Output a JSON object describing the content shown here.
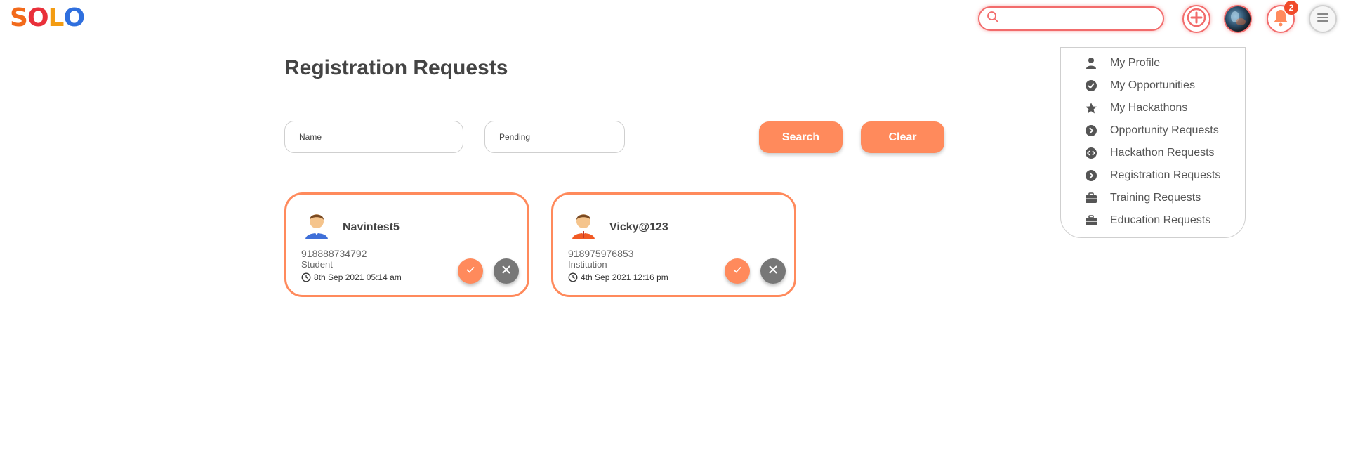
{
  "header": {
    "logo_letters": [
      "S",
      "O",
      "L",
      "O"
    ],
    "search": {
      "value": "",
      "placeholder": ""
    },
    "notification_count": "2",
    "icons": {
      "search": "search-icon",
      "add": "plus-circle-icon",
      "avatar": "user-avatar",
      "notifications": "bell-icon",
      "menu": "hamburger-menu-icon"
    },
    "accent_color": "#f26b6b"
  },
  "dropdown": {
    "items": [
      {
        "label": "My Profile",
        "icon": "user-icon"
      },
      {
        "label": "My Opportunities",
        "icon": "check-circle-icon"
      },
      {
        "label": "My Hackathons",
        "icon": "star-icon"
      },
      {
        "label": "Opportunity Requests",
        "icon": "chevron-circle-icon"
      },
      {
        "label": "Hackathon Requests",
        "icon": "code-circle-icon"
      },
      {
        "label": "Registration Requests",
        "icon": "chevron-circle-icon"
      },
      {
        "label": "Training Requests",
        "icon": "briefcase-icon"
      },
      {
        "label": "Education Requests",
        "icon": "briefcase-icon"
      }
    ]
  },
  "main": {
    "title": "Registration Requests",
    "filters": {
      "name": {
        "value": "",
        "placeholder": "Name"
      },
      "status": {
        "value": "Pending"
      }
    },
    "search_label": "Search",
    "clear_label": "Clear",
    "button_color": "#ff8a5c",
    "requests": [
      {
        "name": "Navintest5",
        "phone": "918888734792",
        "role": "Student",
        "time": "8th Sep 2021 05:14 am",
        "avatar_color": "#3f6fd8"
      },
      {
        "name": "Vicky@123",
        "phone": "918975976853",
        "role": "Institution",
        "time": "4th Sep 2021 12:16 pm",
        "avatar_color": "#f15a24"
      }
    ]
  }
}
